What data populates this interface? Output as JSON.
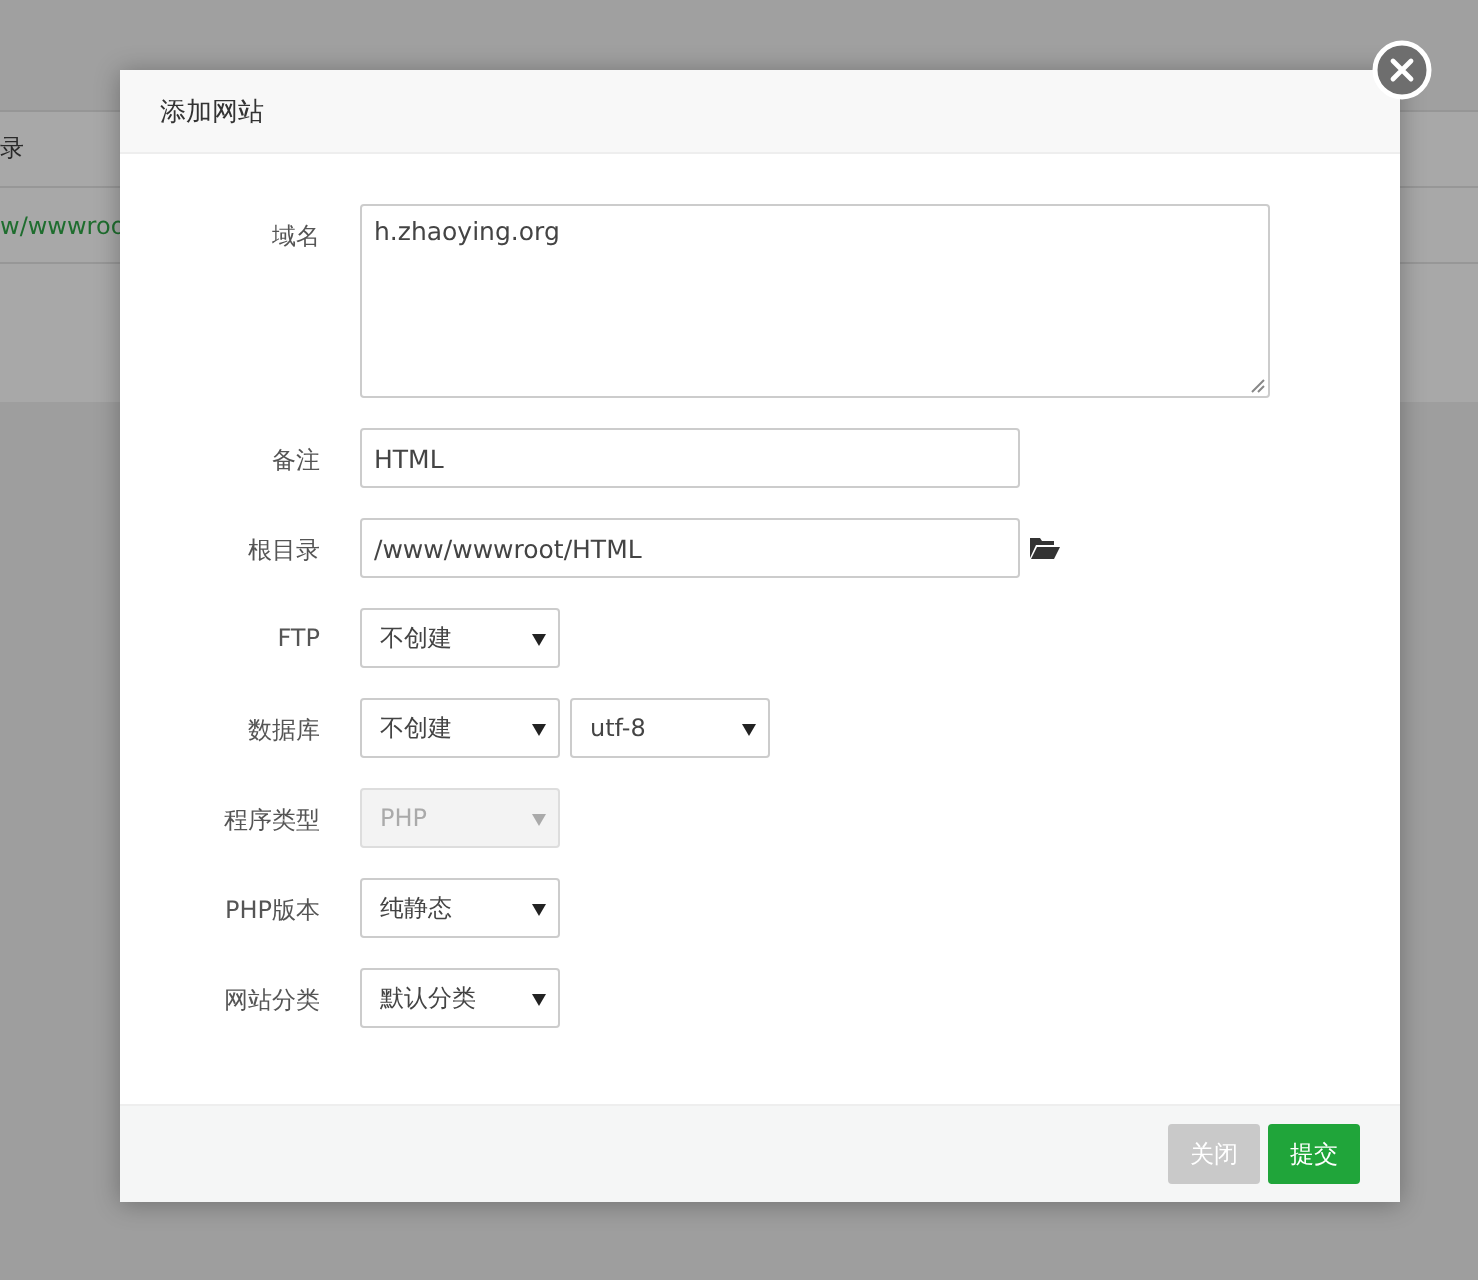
{
  "background_page": {
    "header_cell": "录",
    "link_cell": "w/wwwroo"
  },
  "dialog": {
    "title": "添加网站",
    "rows": [
      {
        "label": "域名",
        "controls": [
          {
            "kind": "textarea",
            "value": "h.zhaoying.org"
          }
        ]
      },
      {
        "label": "备注",
        "controls": [
          {
            "kind": "input",
            "value": "HTML"
          }
        ]
      },
      {
        "label": "根目录",
        "controls": [
          {
            "kind": "input",
            "value": "/www/wwwroot/HTML"
          },
          {
            "kind": "folder"
          }
        ]
      },
      {
        "label": "FTP",
        "controls": [
          {
            "kind": "select",
            "value": "不创建",
            "disabled": false
          }
        ]
      },
      {
        "label": "数据库",
        "controls": [
          {
            "kind": "select",
            "value": "不创建",
            "disabled": false
          },
          {
            "kind": "select",
            "value": "utf-8",
            "disabled": false
          }
        ]
      },
      {
        "label": "程序类型",
        "controls": [
          {
            "kind": "select",
            "value": "PHP",
            "disabled": true
          }
        ]
      },
      {
        "label": "PHP版本",
        "controls": [
          {
            "kind": "select",
            "value": "纯静态",
            "disabled": false
          }
        ]
      },
      {
        "label": "网站分类",
        "controls": [
          {
            "kind": "select",
            "value": "默认分类",
            "disabled": false
          }
        ]
      }
    ],
    "buttons": [
      {
        "label": "关闭",
        "kind": "secondary"
      },
      {
        "label": "提交",
        "kind": "primary"
      }
    ]
  }
}
